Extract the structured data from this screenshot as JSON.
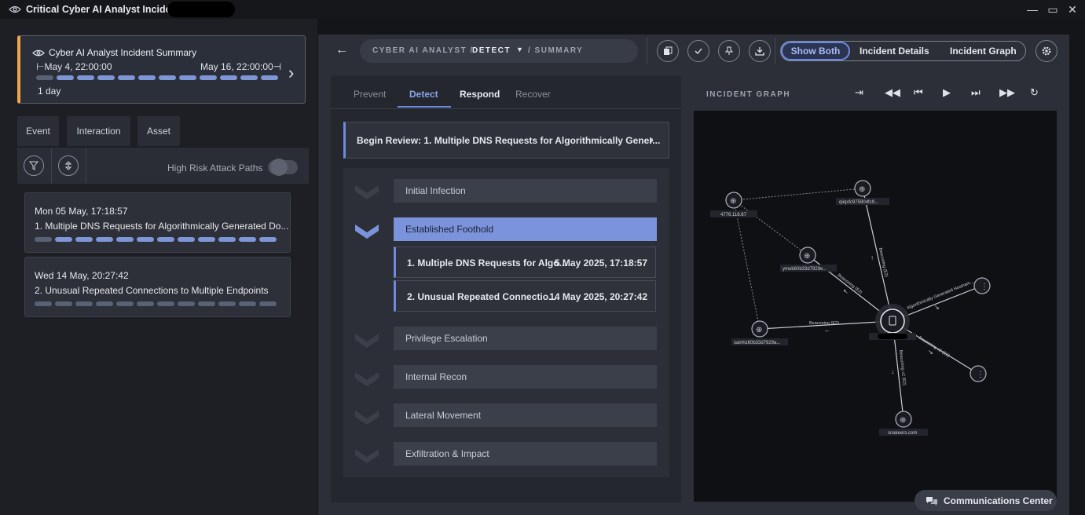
{
  "window": {
    "title": "Critical Cyber AI Analyst Incident -",
    "minimize": "—",
    "maximize": "▭",
    "close": "✕"
  },
  "summary": {
    "title": "Cyber AI Analyst Incident Summary",
    "start": "⊢May 4, 22:00:00",
    "end": "May 16, 22:00:00⊣",
    "duration": "1 day",
    "arrow": "›"
  },
  "left_tabs": [
    "Event",
    "Interaction",
    "Asset"
  ],
  "filters": {
    "high_risk_label": "High Risk Attack Paths",
    "high_risk_on": false
  },
  "events": [
    {
      "date": "Mon 05 May, 17:18:57",
      "name": "1. Multiple DNS Requests for Algorithmically Generated Do..."
    },
    {
      "date": "Wed 14 May, 20:27:42",
      "name": "2. Unusual Repeated Connections to Multiple Endpoints"
    }
  ],
  "breadcrumb": {
    "root": "CYBER AI ANALYST /",
    "current": "DETECT",
    "caret": "▼",
    "leaf": "/ SUMMARY"
  },
  "view_toggle": {
    "show_both": "Show Both",
    "incident_details": "Incident Details",
    "incident_graph": "Incident Graph"
  },
  "phase_tabs": [
    "Prevent",
    "Detect",
    "Respond",
    "Recover"
  ],
  "active_phase": "Detect",
  "begin_review": "Begin Review: 1. Multiple DNS Requests for Algorithmically Gener...",
  "stages": [
    "Initial Infection",
    "Established Foothold",
    "Privilege Escalation",
    "Internal Recon",
    "Lateral Movement",
    "Exfiltration & Impact"
  ],
  "active_stage": "Established Foothold",
  "stage_events": [
    {
      "name": "1. Multiple DNS Requests for Algo...",
      "time": "5 May 2025, 17:18:57"
    },
    {
      "name": "2. Unusual Repeated Connectio...",
      "time": "14 May 2025, 20:27:42"
    }
  ],
  "graph": {
    "title": "INCIDENT GRAPH",
    "nodes": [
      "4776.118.67",
      "qiiqxfc975904fc9...",
      "ymob60b33d7929e...",
      "samhz60b33d7929a...",
      "snakeers.com"
    ],
    "edge_labels": [
      "Beaconing (E2)",
      "Beaconing (E2)",
      "Beaconing (E2)",
      "Beaconing v2 (E2)",
      "Beaconing v2 (E2)",
      "Algorithmically Generated Hostnam..."
    ]
  },
  "communications_center": "Communications Center",
  "colors": {
    "accent": "#6d8ae0",
    "active_stage": "#7b93db",
    "summary_border": "#f0a64b"
  }
}
